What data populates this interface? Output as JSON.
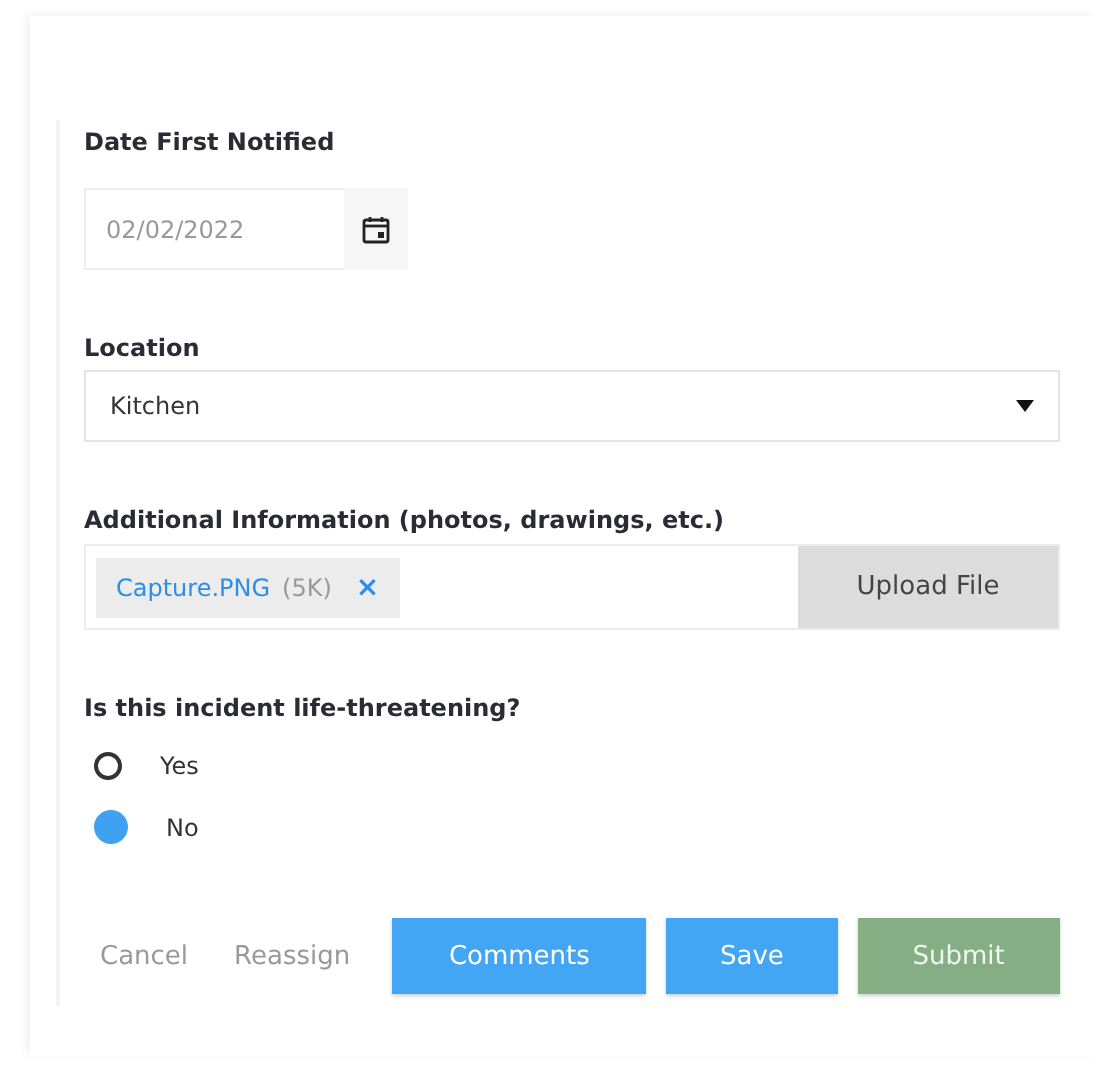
{
  "date_field": {
    "label": "Date First Notified",
    "value": "02/02/2022"
  },
  "location": {
    "label": "Location",
    "value": "Kitchen"
  },
  "attachments": {
    "label": "Additional Information (photos, drawings, etc.)",
    "files": [
      {
        "name": "Capture.PNG",
        "size": "(5K)",
        "remove": "×"
      }
    ],
    "upload_button": "Upload File"
  },
  "question": {
    "label": "Is this incident life-threatening?",
    "options": [
      {
        "label": "Yes",
        "selected": false
      },
      {
        "label": "No",
        "selected": true
      }
    ]
  },
  "buttons": [
    {
      "label": "Cancel",
      "kind": "link"
    },
    {
      "label": "Reassign",
      "kind": "link"
    },
    {
      "label": "Comments",
      "kind": "primary"
    },
    {
      "label": "Save",
      "kind": "primary"
    },
    {
      "label": "Submit",
      "kind": "success"
    }
  ]
}
